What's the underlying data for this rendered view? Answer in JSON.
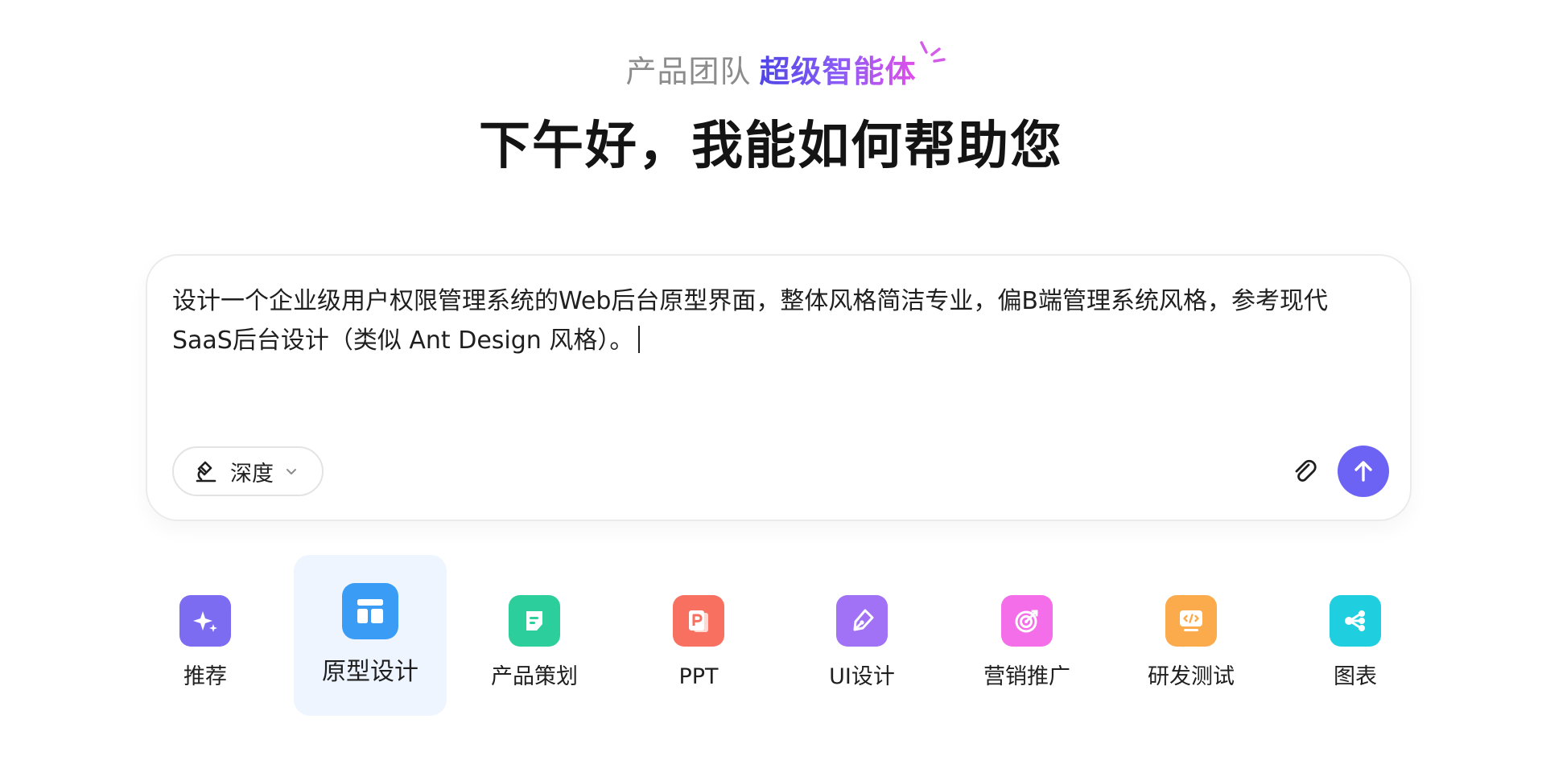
{
  "header": {
    "brand_prefix": "产品团队",
    "brand_highlight": "超级智能体",
    "greeting": "下午好，我能如何帮助您"
  },
  "composer": {
    "text": "设计一个企业级用户权限管理系统的Web后台原型界面，整体风格简洁专业，偏B端管理系统风格，参考现代SaaS后台设计（类似 Ant Design 风格）。",
    "mode_label": "深度",
    "attach_icon": "paperclip-icon",
    "send_icon": "arrow-up-icon",
    "send_color": "#6c63f5"
  },
  "categories": [
    {
      "label": "推荐",
      "icon": "sparkles-icon",
      "color": "#7c6cf2",
      "active": false
    },
    {
      "label": "原型设计",
      "icon": "layout-icon",
      "color": "#3b9cf5",
      "active": true
    },
    {
      "label": "产品策划",
      "icon": "document-icon",
      "color": "#2ccf9b",
      "active": false
    },
    {
      "label": "PPT",
      "icon": "ppt-icon",
      "color": "#f8705f",
      "active": false
    },
    {
      "label": "UI设计",
      "icon": "pen-nib-icon",
      "color": "#a172f5",
      "active": false
    },
    {
      "label": "营销推广",
      "icon": "target-icon",
      "color": "#f36ee8",
      "active": false
    },
    {
      "label": "研发测试",
      "icon": "code-icon",
      "color": "#fbab4c",
      "active": false
    },
    {
      "label": "图表",
      "icon": "share-nodes-icon",
      "color": "#1fcfe0",
      "active": false
    }
  ]
}
